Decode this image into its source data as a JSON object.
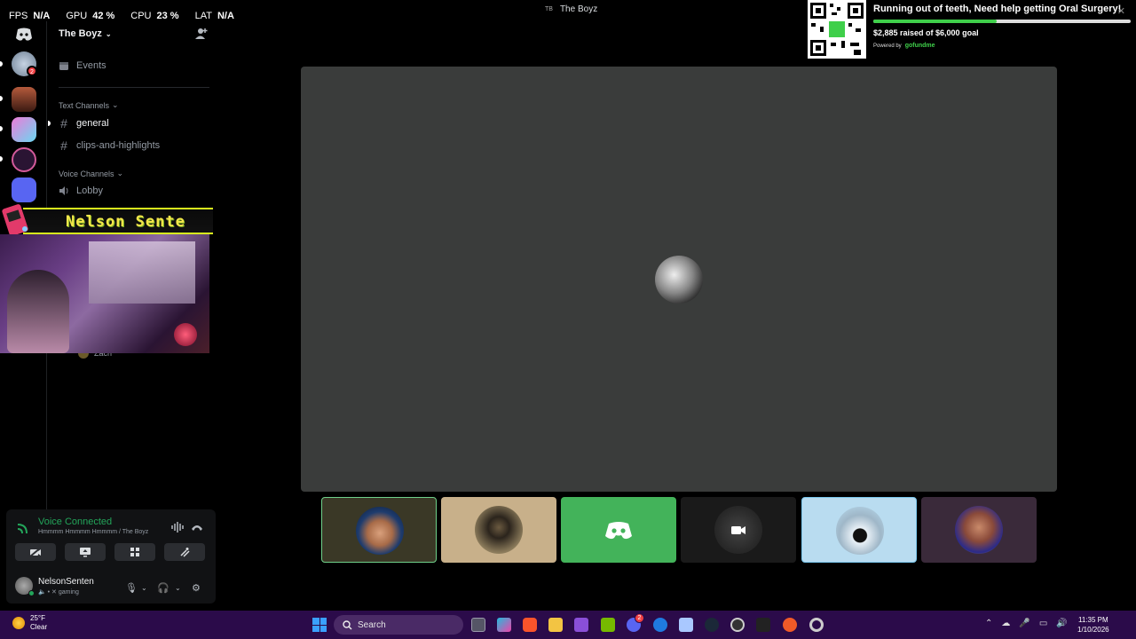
{
  "overlay": {
    "stats": [
      {
        "label": "FPS",
        "value": "N/A"
      },
      {
        "label": "GPU",
        "value": "42 %"
      },
      {
        "label": "CPU",
        "value": "23 %"
      },
      {
        "label": "LAT",
        "value": "N/A"
      }
    ]
  },
  "window": {
    "badge": "TB",
    "title": "The Boyz"
  },
  "rail": {
    "badges": [
      "2"
    ]
  },
  "sidebar": {
    "server_name": "The Boyz",
    "events_label": "Events",
    "text_category": "Text Channels",
    "voice_category": "Voice Channels",
    "text_channels": [
      {
        "name": "general",
        "active": true
      },
      {
        "name": "clips-and-highlights",
        "active": false
      }
    ],
    "voice_channels": [
      {
        "name": "Lobby"
      }
    ],
    "voice_members": [
      {
        "name": "Zach"
      }
    ]
  },
  "webcam": {
    "banner_text": "Nelson Sente"
  },
  "voice_panel": {
    "status": "Voice Connected",
    "location": "Hmmmm Hmmmm Hmmmm / The Boyz",
    "user_name": "NelsonSenten",
    "user_status": "gaming"
  },
  "fundraiser": {
    "title": "Running out of teeth, Need help getting Oral Surgery!",
    "raised_text": "$2,885 raised of $6,000 goal",
    "raised": 2885,
    "goal": 6000,
    "powered_by": "Powered by",
    "brand": "gofundme"
  },
  "taskbar": {
    "temperature": "25°F",
    "condition": "Clear",
    "search_placeholder": "Search",
    "time": "11:35 PM",
    "date": "1/10/2026",
    "discord_badge": "2"
  },
  "colors": {
    "accent_green": "#23a55a",
    "stage_bg": "#3a3c3b",
    "discord_tile": "#43b35a",
    "taskbar": "#2b0b4a"
  }
}
